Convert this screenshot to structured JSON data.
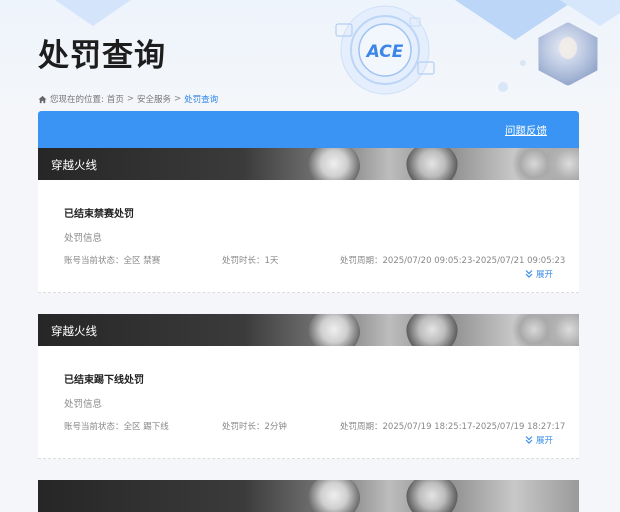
{
  "page": {
    "title": "处罚查询"
  },
  "breadcrumb": {
    "prefix": "您现在的位置:",
    "items": [
      "首页",
      "安全服务"
    ],
    "separator": ">",
    "current": "处罚查询"
  },
  "panel": {
    "feedback_label": "问题反馈"
  },
  "records": [
    {
      "game": "穿越火线",
      "status_title": "已结束禁赛处罚",
      "info_label": "处罚信息",
      "account_status": "账号当前状态：全区 禁赛",
      "duration": "处罚时长：1天",
      "period": "处罚周期：2025/07/20 09:05:23-2025/07/21 09:05:23",
      "expand_label": "展开"
    },
    {
      "game": "穿越火线",
      "status_title": "已结束踢下线处罚",
      "info_label": "处罚信息",
      "account_status": "账号当前状态：全区 踢下线",
      "duration": "处罚时长：2分钟",
      "period": "处罚周期：2025/07/19 18:25:17-2025/07/19 18:27:17",
      "expand_label": "展开"
    }
  ],
  "colors": {
    "accent": "#3a94f4",
    "link": "#2f86e8",
    "background": "#f4f6f9"
  },
  "icons": {
    "home": "home-icon",
    "expand": "chevron-double-down-icon",
    "logo": "ace-logo"
  }
}
